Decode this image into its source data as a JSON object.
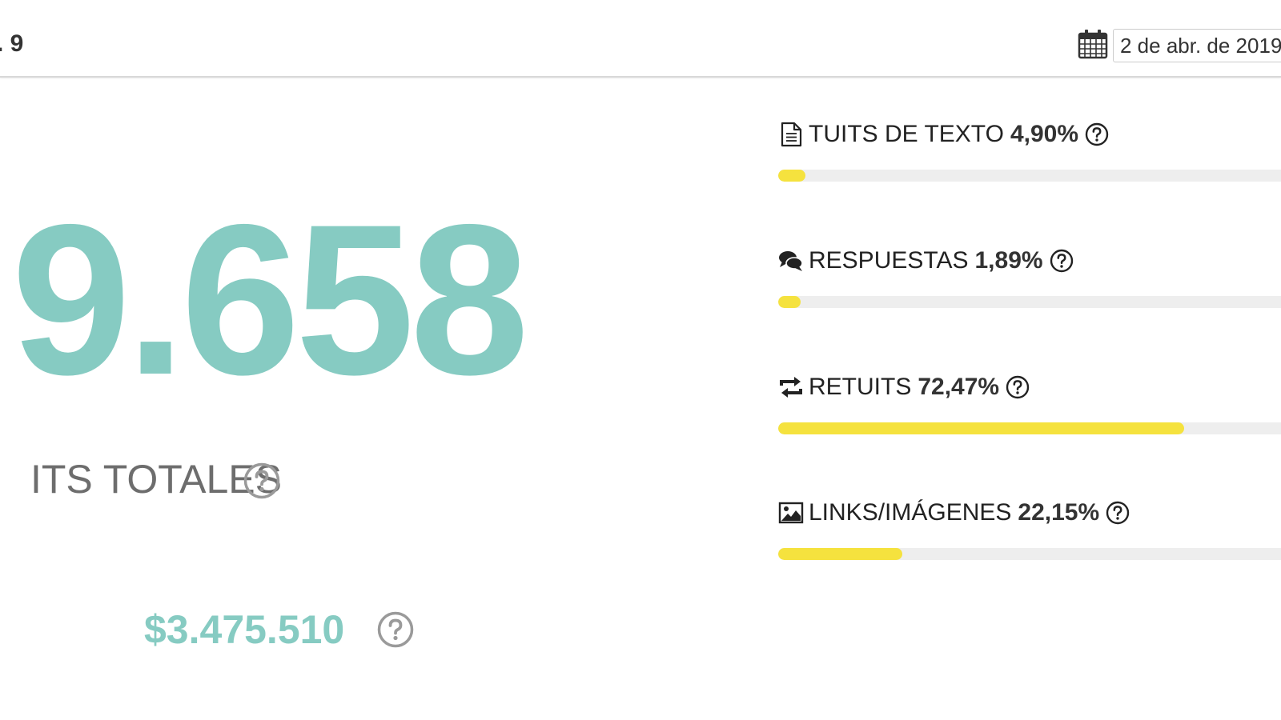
{
  "header": {
    "title_fragment": ". 9",
    "date_value": "2 de abr. de 2019"
  },
  "summary": {
    "big_number": "9.658",
    "total_label": "ITS TOTALES",
    "money_value": "$3.475.510"
  },
  "breakdown": [
    {
      "icon": "document-icon",
      "label": "TUITS DE TEXTO",
      "percent_text": "4,90%",
      "percent": 4.9
    },
    {
      "icon": "comments-icon",
      "label": "RESPUESTAS",
      "percent_text": "1,89%",
      "percent": 1.89
    },
    {
      "icon": "retweet-icon",
      "label": "RETUITS",
      "percent_text": "72,47%",
      "percent": 72.47
    },
    {
      "icon": "image-icon",
      "label": "LINKS/IMÁGENES",
      "percent_text": "22,15%",
      "percent": 22.15
    }
  ],
  "colors": {
    "accent_teal": "#86cbc2",
    "bar_fill": "#f5e23e",
    "bar_track": "#eeeeee",
    "muted_text": "#6d6d6d"
  }
}
